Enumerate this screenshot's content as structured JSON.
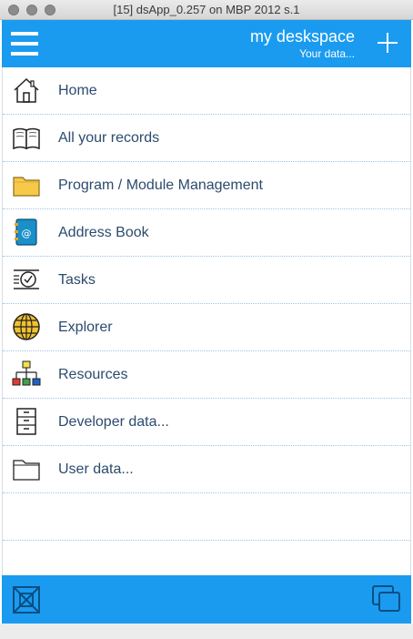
{
  "window": {
    "title": "[15] dsApp_0.257 on MBP 2012 s.1"
  },
  "header": {
    "title": "my deskspace",
    "subtitle": "Your data..."
  },
  "menu": {
    "items": [
      {
        "label": "Home",
        "icon": "home-icon"
      },
      {
        "label": "All your records",
        "icon": "book-icon"
      },
      {
        "label": "Program / Module Management",
        "icon": "folder-icon"
      },
      {
        "label": "Address Book",
        "icon": "address-book-icon"
      },
      {
        "label": "Tasks",
        "icon": "tasks-icon"
      },
      {
        "label": "Explorer",
        "icon": "globe-icon"
      },
      {
        "label": "Resources",
        "icon": "hierarchy-icon"
      },
      {
        "label": "Developer data...",
        "icon": "cabinet-icon"
      },
      {
        "label": "User data...",
        "icon": "folder-outline-icon"
      }
    ]
  },
  "footer": {
    "left_icon": "collapse-icon",
    "right_icon": "windows-icon"
  },
  "colors": {
    "accent": "#1a9bf0",
    "label": "#2b4b6e",
    "divider": "#9fc4e3"
  }
}
